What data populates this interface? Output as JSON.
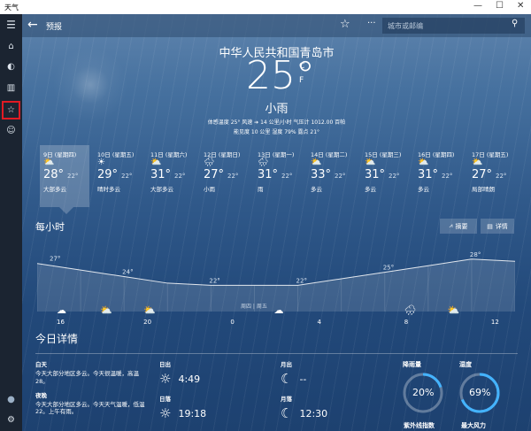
{
  "window": {
    "title": "天气",
    "controls": [
      "—",
      "☐",
      "✕"
    ]
  },
  "rail": {
    "items": [
      {
        "name": "menu-icon",
        "glyph": "☰"
      },
      {
        "name": "home-icon",
        "glyph": "⌂"
      },
      {
        "name": "map-icon",
        "glyph": "◐"
      },
      {
        "name": "history-icon",
        "glyph": "▥"
      },
      {
        "name": "favorites-icon",
        "glyph": "☆"
      },
      {
        "name": "emoji-icon",
        "glyph": "☺"
      }
    ],
    "bottom": [
      {
        "name": "account-icon",
        "glyph": "●"
      },
      {
        "name": "settings-icon",
        "glyph": "⚙"
      }
    ]
  },
  "topbar": {
    "back": "←",
    "title": "预报",
    "star": "☆",
    "more": "···",
    "search_placeholder": "城市或邮编",
    "search_icon": "⚲"
  },
  "current": {
    "city": "中华人民共和国青岛市",
    "temp": "25°",
    "unit_c": "C",
    "unit_f": "F",
    "condition": "小雨",
    "details1": "体感温度 25°    风速 ➔ 14 公里/小时    气压计 1012.00 百帕",
    "details2": "能见度 10 公里    湿度 79%    露点 21°"
  },
  "forecast": [
    {
      "day": "9日 (星期四)",
      "icon": "⛅",
      "hi": "28°",
      "lo": "22°",
      "cond": "大部多云"
    },
    {
      "day": "10日 (星期五)",
      "icon": "☀",
      "hi": "29°",
      "lo": "22°",
      "cond": "晴时多云"
    },
    {
      "day": "11日 (星期六)",
      "icon": "⛅",
      "hi": "31°",
      "lo": "22°",
      "cond": "大部多云"
    },
    {
      "day": "12日 (星期日)",
      "icon": "🌧",
      "hi": "27°",
      "lo": "22°",
      "cond": "小雨"
    },
    {
      "day": "13日 (星期一)",
      "icon": "🌧",
      "hi": "31°",
      "lo": "22°",
      "cond": "雨"
    },
    {
      "day": "14日 (星期二)",
      "icon": "⛅",
      "hi": "33°",
      "lo": "22°",
      "cond": "多云"
    },
    {
      "day": "15日 (星期三)",
      "icon": "⛅",
      "hi": "31°",
      "lo": "22°",
      "cond": "多云"
    },
    {
      "day": "16日 (星期四)",
      "icon": "⛅",
      "hi": "31°",
      "lo": "22°",
      "cond": "多云"
    },
    {
      "day": "17日 (星期五)",
      "icon": "⛅",
      "hi": "27°",
      "lo": "22°",
      "cond": "局部晴朗"
    }
  ],
  "hourly": {
    "title": "每小时",
    "summary_btn": "摘要",
    "detail_btn": "详情",
    "day_label": "周四 | 周五"
  },
  "chart_data": {
    "type": "line",
    "x": [
      "16",
      "18",
      "20",
      "22",
      "0",
      "2",
      "4",
      "6",
      "8",
      "10",
      "12",
      "14"
    ],
    "x_ticks": [
      "16",
      "20",
      "0",
      "4",
      "8",
      "12"
    ],
    "values": [
      27,
      25.5,
      24,
      22.5,
      22,
      22,
      22,
      23.5,
      25,
      26.5,
      28,
      27.5
    ],
    "point_labels": [
      {
        "index": 0,
        "text": "27°"
      },
      {
        "index": 2,
        "text": "24°"
      },
      {
        "index": 4,
        "text": "22°"
      },
      {
        "index": 6,
        "text": "22°"
      },
      {
        "index": 8,
        "text": "25°"
      },
      {
        "index": 10,
        "text": "28°"
      }
    ],
    "icons": [
      {
        "index": 0,
        "glyph": "☁"
      },
      {
        "index": 1,
        "glyph": "⛅"
      },
      {
        "index": 2,
        "glyph": "⛅"
      },
      {
        "index": 5,
        "glyph": "☁"
      },
      {
        "index": 8,
        "glyph": "🌧"
      },
      {
        "index": 9,
        "glyph": "⛅"
      }
    ],
    "ylim": [
      16,
      31
    ],
    "title": "",
    "xlabel": "",
    "ylabel": ""
  },
  "today": {
    "title": "今日详情",
    "day_label": "白天",
    "day_text": "今天大部分地区多云。今天很温暖，高温 28。",
    "night_label": "夜晚",
    "night_text": "今天大部分地区多云。今天天气温暖，低温 22。上午有雨。",
    "sunrise_label": "日出",
    "sunrise_icon": "☼",
    "sunrise": "4:49",
    "sunset_label": "日落",
    "sunset_icon": "☼",
    "sunset": "19:18",
    "moonrise_label": "月出",
    "moonrise_icon": "☾",
    "moonrise": "--",
    "moonset_label": "月落",
    "moonset_icon": "☾",
    "moonset": "12:30",
    "precip_label": "降雨量",
    "precip": "20%",
    "precip_value": 20,
    "humidity_label": "湿度",
    "humidity": "69%",
    "humidity_value": 69,
    "uv_label": "紫外线指数",
    "wind_label": "最大风力"
  }
}
